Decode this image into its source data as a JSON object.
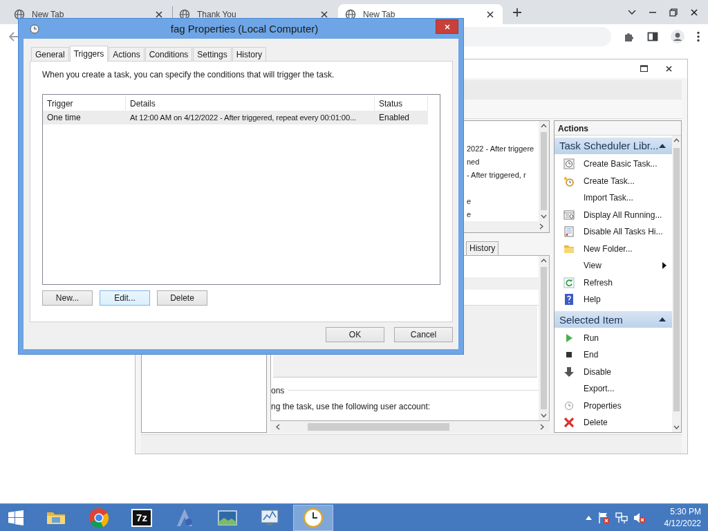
{
  "browser": {
    "tabs": [
      {
        "title": "New Tab",
        "selected": false
      },
      {
        "title": "Thank You",
        "selected": false
      },
      {
        "title": "New Tab",
        "selected": true
      }
    ]
  },
  "task_scheduler": {
    "list_fragments": [
      [
        "2022 - After triggere",
        "ned",
        "- After triggered, r"
      ],
      [
        "e",
        "e"
      ]
    ],
    "detail_tabs": [
      {
        "label": "History",
        "selected": false
      }
    ],
    "detail_section": {
      "heading": "ons",
      "text": "ng the task, use the following user account:"
    },
    "actions": {
      "header": "Actions",
      "sections": [
        {
          "title": "Task Scheduler Libr...",
          "expanded": true,
          "items": [
            {
              "label": "Create Basic Task...",
              "submenu": false
            },
            {
              "label": "Create Task...",
              "submenu": false
            },
            {
              "label": "Import Task...",
              "submenu": false
            },
            {
              "label": "Display All Running...",
              "submenu": false
            },
            {
              "label": "Disable All Tasks Hi...",
              "submenu": false
            },
            {
              "label": "New Folder...",
              "submenu": false
            },
            {
              "label": "View",
              "submenu": true
            },
            {
              "label": "Refresh",
              "submenu": false
            },
            {
              "label": "Help",
              "submenu": false
            }
          ]
        },
        {
          "title": "Selected Item",
          "expanded": true,
          "items": [
            {
              "label": "Run",
              "submenu": false
            },
            {
              "label": "End",
              "submenu": false
            },
            {
              "label": "Disable",
              "submenu": false
            },
            {
              "label": "Export...",
              "submenu": false
            },
            {
              "label": "Properties",
              "submenu": false
            },
            {
              "label": "Delete",
              "submenu": false
            }
          ]
        }
      ]
    }
  },
  "dialog": {
    "title": "fag Properties (Local Computer)",
    "tabs": [
      {
        "label": "General",
        "selected": false
      },
      {
        "label": "Triggers",
        "selected": true
      },
      {
        "label": "Actions",
        "selected": false
      },
      {
        "label": "Conditions",
        "selected": false
      },
      {
        "label": "Settings",
        "selected": false
      },
      {
        "label": "History",
        "selected": false
      }
    ],
    "description": "When you create a task, you can specify the conditions that will trigger the task.",
    "columns": [
      "Trigger",
      "Details",
      "Status"
    ],
    "rows": [
      {
        "cells": [
          "One time",
          "At 12:00 AM on 4/12/2022 - After triggered, repeat every 00:01:00...",
          "Enabled"
        ],
        "selected": true
      }
    ],
    "list_buttons": [
      {
        "label": "New...",
        "focused": false
      },
      {
        "label": "Edit...",
        "focused": true
      },
      {
        "label": "Delete",
        "focused": false
      }
    ],
    "buttons": [
      "OK",
      "Cancel"
    ]
  },
  "taskbar": {
    "apps": [
      {
        "selected": false
      },
      {
        "selected": false
      },
      {
        "selected": false,
        "label": "7z"
      },
      {
        "selected": false
      },
      {
        "selected": false
      },
      {
        "selected": false
      },
      {
        "selected": true
      }
    ],
    "time": "5:30 PM",
    "date": "4/12/2022"
  }
}
